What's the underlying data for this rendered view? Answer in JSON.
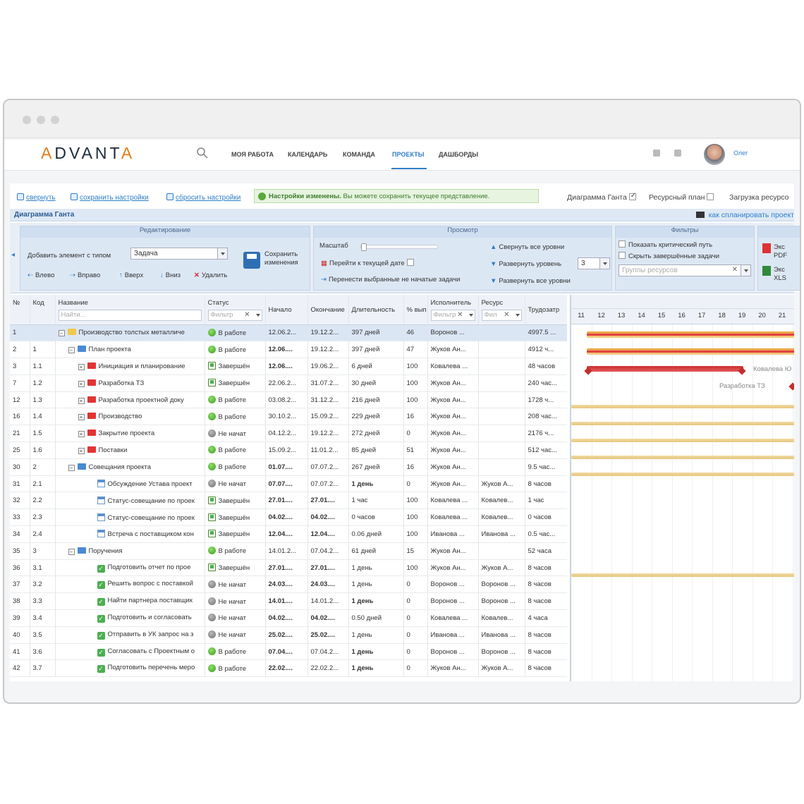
{
  "header": {
    "logo": "ADVANTA",
    "nav": [
      "МОЯ РАБОТА",
      "КАЛЕНДАРЬ",
      "КОМАНДА",
      "ПРОЕКТЫ",
      "ДАШБОРДЫ"
    ],
    "active_nav": "ПРОЕКТЫ",
    "user": "Олег"
  },
  "toolbar": {
    "collapse": "свернуть",
    "save_settings": "сохранить настройки",
    "reset_settings": "сбросить настройки",
    "notice_bold": "Настройки изменены.",
    "notice_text": " Вы можете сохранить текущее представление.",
    "opt_gantt": "Диаграмма Ганта",
    "opt_resource": "Ресурсный план",
    "opt_load": "Загрузка ресурсо"
  },
  "titlebar": {
    "title": "Диаграмма Ганта",
    "howto": "как спланировать проект"
  },
  "ribbon": {
    "edit": {
      "title": "Редактирование",
      "add_label": "Добавить элемент с типом",
      "type_value": "Задача",
      "save_line1": "Сохранить",
      "save_line2": "изменения",
      "left": "Влево",
      "right": "Вправо",
      "up": "Вверх",
      "down": "Вниз",
      "delete": "Удалить"
    },
    "view": {
      "title": "Просмотр",
      "scale": "Масштаб",
      "goto_date": "Перейти к текущей дате",
      "move_selected": "Перенести выбранные не начатые задачи",
      "collapse_all": "Свернуть все уровни",
      "expand_level": "Развернуть уровень",
      "level_value": "3",
      "expand_all": "Развернуть все уровни"
    },
    "filters": {
      "title": "Фильтры",
      "critical": "Показать критический путь",
      "hide_done": "Скрыть завершённые задачи",
      "groups_placeholder": "Группы ресурсов"
    },
    "export": {
      "pdf_top": "Экс",
      "pdf_bottom": "PDF",
      "xls_top": "Экс",
      "xls_bottom": "XLS"
    }
  },
  "grid": {
    "headers": {
      "num": "№",
      "code": "Код",
      "name": "Название",
      "name_filter": "Найти...",
      "status": "Статус",
      "status_filter": "Фильтр",
      "start": "Начало",
      "end": "Окончание",
      "duration": "Длительность",
      "percent": "% вып",
      "executor": "Исполнитель",
      "exec_filter": "Фильтр",
      "resource": "Ресурс",
      "res_filter": "Фил",
      "labor": "Трудозатр"
    },
    "rows": [
      {
        "n": "1",
        "code": "",
        "name": "Производство толстых металличе",
        "icon": "yel",
        "tree": "−",
        "lvl": 0,
        "status": "В работе",
        "st": "work",
        "start": "12.06.2...",
        "end": "19.12.2...",
        "dur": "397 дней",
        "pct": "46",
        "exec": "Воронов ...",
        "res": "",
        "labor": "4997.5 ...",
        "sb": false,
        "eb": false,
        "db": false,
        "sel": true
      },
      {
        "n": "2",
        "code": "1",
        "name": "План проекта",
        "icon": "blue",
        "tree": "−",
        "lvl": 1,
        "status": "В работе",
        "st": "work",
        "start": "12.06....",
        "end": "19.12.2...",
        "dur": "397 дней",
        "pct": "47",
        "exec": "Жуков Ан...",
        "res": "",
        "labor": "4912 ч...",
        "sb": true,
        "eb": false,
        "db": false
      },
      {
        "n": "3",
        "code": "1.1",
        "name": "Инициация и планирование",
        "icon": "red",
        "tree": "+",
        "lvl": 2,
        "status": "Завершён",
        "st": "done",
        "start": "12.06....",
        "end": "19.06.2...",
        "dur": "6 дней",
        "pct": "100",
        "exec": "Ковалева ...",
        "res": "",
        "labor": "48 часов",
        "sb": true,
        "eb": false,
        "db": false
      },
      {
        "n": "7",
        "code": "1.2",
        "name": "Разработка ТЗ",
        "icon": "red",
        "tree": "+",
        "lvl": 2,
        "status": "Завершён",
        "st": "done",
        "start": "22.06.2...",
        "end": "31.07.2...",
        "dur": "30 дней",
        "pct": "100",
        "exec": "Жуков Ан...",
        "res": "",
        "labor": "240 час...",
        "sb": false,
        "eb": false,
        "db": false
      },
      {
        "n": "12",
        "code": "1.3",
        "name": "Разработка проектной доку",
        "icon": "red",
        "tree": "+",
        "lvl": 2,
        "status": "В работе",
        "st": "work",
        "start": "03.08.2...",
        "end": "31.12.2...",
        "dur": "216 дней",
        "pct": "100",
        "exec": "Жуков Ан...",
        "res": "",
        "labor": "1728 ч...",
        "sb": false,
        "eb": false,
        "db": false
      },
      {
        "n": "16",
        "code": "1.4",
        "name": "Производство",
        "icon": "red",
        "tree": "+",
        "lvl": 2,
        "status": "В работе",
        "st": "work",
        "start": "30.10.2...",
        "end": "15.09.2...",
        "dur": "229 дней",
        "pct": "16",
        "exec": "Жуков Ан...",
        "res": "",
        "labor": "208 час...",
        "sb": false,
        "eb": false,
        "db": false
      },
      {
        "n": "21",
        "code": "1.5",
        "name": "Закрытие проекта",
        "icon": "red",
        "tree": "+",
        "lvl": 2,
        "status": "Не начат",
        "st": "none",
        "start": "04.12.2...",
        "end": "19.12.2...",
        "dur": "272 дней",
        "pct": "0",
        "exec": "Жуков Ан...",
        "res": "",
        "labor": "2176 ч...",
        "sb": false,
        "eb": false,
        "db": false
      },
      {
        "n": "25",
        "code": "1.6",
        "name": "Поставки",
        "icon": "red",
        "tree": "+",
        "lvl": 2,
        "status": "В работе",
        "st": "work",
        "start": "15.09.2...",
        "end": "11.01.2...",
        "dur": "85 дней",
        "pct": "51",
        "exec": "Жуков Ан...",
        "res": "",
        "labor": "512 час...",
        "sb": false,
        "eb": false,
        "db": false
      },
      {
        "n": "30",
        "code": "2",
        "name": "Совещания проекта",
        "icon": "blue",
        "tree": "−",
        "lvl": 1,
        "status": "В работе",
        "st": "work",
        "start": "01.07....",
        "end": "07.07.2...",
        "dur": "267 дней",
        "pct": "16",
        "exec": "Жуков Ан...",
        "res": "",
        "labor": "9.5 час...",
        "sb": true,
        "eb": false,
        "db": false
      },
      {
        "n": "31",
        "code": "2.1",
        "name": "Обсуждение Устава проект",
        "icon": "cal",
        "tree": "",
        "lvl": 3,
        "status": "Не начат",
        "st": "none",
        "start": "07.07....",
        "end": "07.07.2...",
        "dur": "1 день",
        "pct": "0",
        "exec": "Жуков Ан...",
        "res": "Жуков А...",
        "labor": "8 часов",
        "sb": true,
        "eb": false,
        "db": true
      },
      {
        "n": "32",
        "code": "2.2",
        "name": "Статус-совещание по проек",
        "icon": "cal",
        "tree": "",
        "lvl": 3,
        "status": "Завершён",
        "st": "done",
        "start": "27.01....",
        "end": "27.01....",
        "dur": "1 час",
        "pct": "100",
        "exec": "Ковалева ...",
        "res": "Ковалев...",
        "labor": "1 час",
        "sb": true,
        "eb": true,
        "db": false
      },
      {
        "n": "33",
        "code": "2.3",
        "name": "Статус-совещание по проек",
        "icon": "cal",
        "tree": "",
        "lvl": 3,
        "status": "Завершён",
        "st": "done",
        "start": "04.02....",
        "end": "04.02....",
        "dur": "0 часов",
        "pct": "100",
        "exec": "Ковалева ...",
        "res": "Ковалев...",
        "labor": "0 часов",
        "sb": true,
        "eb": true,
        "db": false
      },
      {
        "n": "34",
        "code": "2.4",
        "name": "Встреча с поставщиком кон",
        "icon": "cal",
        "tree": "",
        "lvl": 3,
        "status": "Завершён",
        "st": "done",
        "start": "12.04....",
        "end": "12.04....",
        "dur": "0.06 дней",
        "pct": "100",
        "exec": "Иванова ...",
        "res": "Иванова ...",
        "labor": "0.5 час...",
        "sb": true,
        "eb": true,
        "db": false
      },
      {
        "n": "35",
        "code": "3",
        "name": "Поручения",
        "icon": "blue",
        "tree": "−",
        "lvl": 1,
        "status": "В работе",
        "st": "work",
        "start": "14.01.2...",
        "end": "07.04.2...",
        "dur": "61 дней",
        "pct": "15",
        "exec": "Жуков Ан...",
        "res": "",
        "labor": "52 часа",
        "sb": false,
        "eb": false,
        "db": false
      },
      {
        "n": "36",
        "code": "3.1",
        "name": "Подготовить отчет по прое",
        "icon": "chk",
        "tree": "",
        "lvl": 3,
        "status": "Завершён",
        "st": "done",
        "start": "27.01....",
        "end": "27.01....",
        "dur": "1 день",
        "pct": "100",
        "exec": "Жуков Ан...",
        "res": "Жуков А...",
        "labor": "8 часов",
        "sb": true,
        "eb": true,
        "db": false
      },
      {
        "n": "37",
        "code": "3.2",
        "name": "Решить вопрос с поставкой",
        "icon": "chk",
        "tree": "",
        "lvl": 3,
        "status": "Не начат",
        "st": "none",
        "start": "24.03....",
        "end": "24.03....",
        "dur": "1 день",
        "pct": "0",
        "exec": "Воронов ...",
        "res": "Воронов ...",
        "labor": "8 часов",
        "sb": true,
        "eb": true,
        "db": false
      },
      {
        "n": "38",
        "code": "3.3",
        "name": "Найти партнера поставщик",
        "icon": "chk",
        "tree": "",
        "lvl": 3,
        "status": "Не начат",
        "st": "none",
        "start": "14.01....",
        "end": "14.01.2...",
        "dur": "1 день",
        "pct": "0",
        "exec": "Воронов ...",
        "res": "Воронов ...",
        "labor": "8 часов",
        "sb": true,
        "eb": false,
        "db": true
      },
      {
        "n": "39",
        "code": "3.4",
        "name": "Подготовить и согласовать",
        "icon": "chk",
        "tree": "",
        "lvl": 3,
        "status": "Не начат",
        "st": "none",
        "start": "04.02....",
        "end": "04.02....",
        "dur": "0.50 дней",
        "pct": "0",
        "exec": "Ковалева ...",
        "res": "Ковалев...",
        "labor": "4 часа",
        "sb": true,
        "eb": true,
        "db": false
      },
      {
        "n": "40",
        "code": "3.5",
        "name": "Отправить в УК запрос на з",
        "icon": "chk",
        "tree": "",
        "lvl": 3,
        "status": "Не начат",
        "st": "none",
        "start": "25.02....",
        "end": "25.02....",
        "dur": "1 день",
        "pct": "0",
        "exec": "Иванова ...",
        "res": "Иванова ...",
        "labor": "8 часов",
        "sb": true,
        "eb": true,
        "db": false
      },
      {
        "n": "41",
        "code": "3.6",
        "name": "Согласовать с Проектным о",
        "icon": "chk",
        "tree": "",
        "lvl": 3,
        "status": "В работе",
        "st": "work",
        "start": "07.04....",
        "end": "07.04.2...",
        "dur": "1 день",
        "pct": "0",
        "exec": "Воронов ...",
        "res": "Воронов ...",
        "labor": "8 часов",
        "sb": true,
        "eb": false,
        "db": true
      },
      {
        "n": "42",
        "code": "3.7",
        "name": "Подготовить перечень меро",
        "icon": "chk",
        "tree": "",
        "lvl": 3,
        "status": "В работе",
        "st": "work",
        "start": "22.02....",
        "end": "22.02.2...",
        "dur": "1 день",
        "pct": "0",
        "exec": "Жуков Ан...",
        "res": "Жуков А...",
        "labor": "8 часов",
        "sb": true,
        "eb": false,
        "db": true
      }
    ]
  },
  "gantt": {
    "days": [
      "11",
      "12",
      "13",
      "14",
      "15",
      "16",
      "17",
      "18",
      "19",
      "20",
      "21"
    ],
    "label_kovaleva": "Ковалева Ю",
    "label_tz": "Разработка ТЗ"
  }
}
